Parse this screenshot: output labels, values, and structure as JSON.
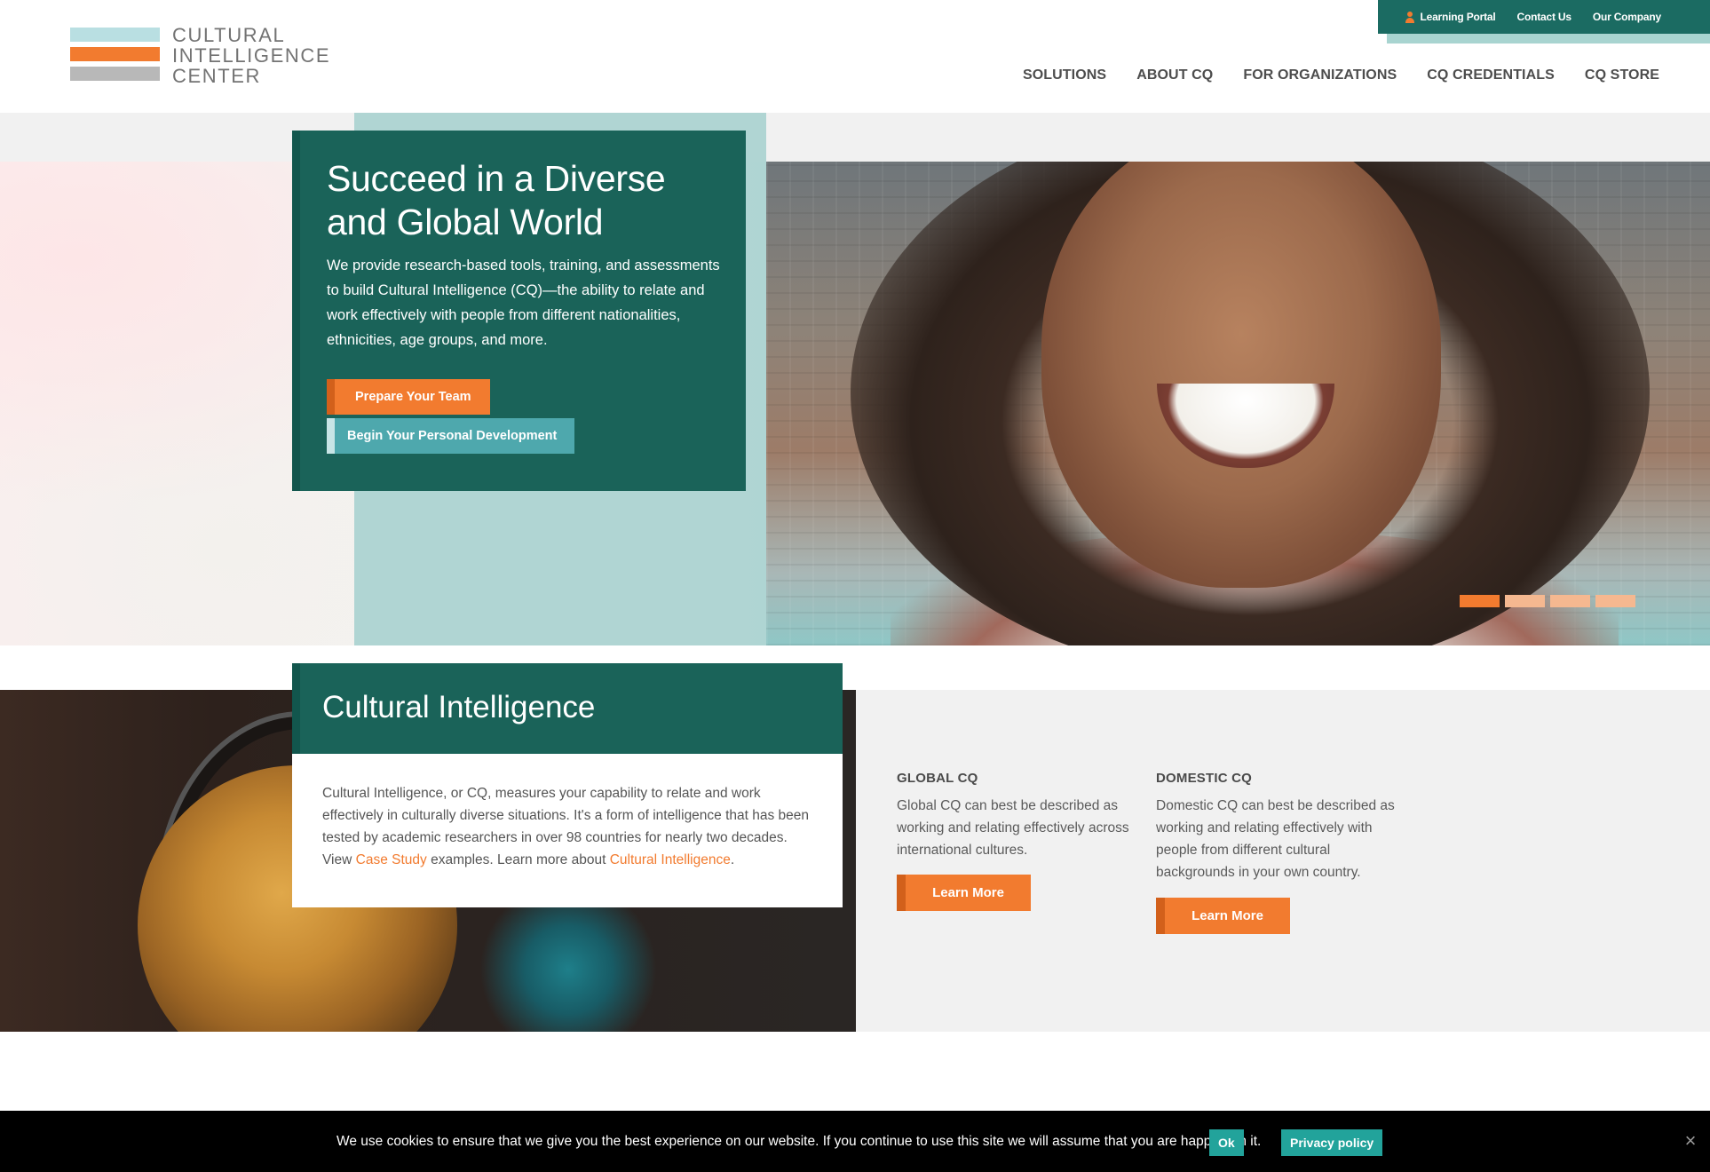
{
  "logo": {
    "lines": [
      "CULTURAL",
      "INTELLIGENCE",
      "CENTER"
    ]
  },
  "utility_nav": {
    "learning_portal": "Learning Portal",
    "contact_us": "Contact Us",
    "our_company": "Our Company"
  },
  "main_nav": [
    "SOLUTIONS",
    "ABOUT CQ",
    "FOR ORGANIZATIONS",
    "CQ CREDENTIALS",
    "CQ STORE"
  ],
  "hero": {
    "title": "Succeed in a Diverse and Global World",
    "body": "We provide research-based tools, training, and assessments to build Cultural Intelligence (CQ)—the ability to relate and work effectively with people from different nationalities, ethnicities, age groups, and more.",
    "primary_button": "Prepare Your Team",
    "secondary_button": "Begin Your Personal Development",
    "slides_total": 4,
    "active_slide": 1
  },
  "cultural_intelligence": {
    "title": "Cultural Intelligence",
    "body_before_link1": "Cultural Intelligence, or CQ, measures your capability to relate and work effectively in culturally diverse situations. It's a form of intelligence that has been tested by academic researchers in over 98 countries for nearly two decades.  View ",
    "link1": "Case Study",
    "between_links": " examples.  Learn more about ",
    "link2": "Cultural Intelligence",
    "after_link2": "."
  },
  "global_cq": {
    "heading": "GLOBAL CQ",
    "body": "Global CQ can best be described as working and relating effectively across international cultures.",
    "button": "Learn More"
  },
  "domestic_cq": {
    "heading": "DOMESTIC CQ",
    "body": "Domestic CQ can best be described as working and relating effectively with people from different cultural backgrounds in your own country.",
    "button": "Learn More"
  },
  "cookie_bar": {
    "text": "We use cookies to ensure that we give you the best experience on our website. If you continue to use this site we will assume that you are happy with it.",
    "ok": "Ok",
    "privacy": "Privacy policy",
    "close": "×"
  },
  "colors": {
    "brand_teal": "#1a6359",
    "brand_orange": "#f27b2f",
    "light_teal": "#4ea8ad",
    "mint": "#a9d2cf",
    "cookie_button": "#22a39b"
  }
}
